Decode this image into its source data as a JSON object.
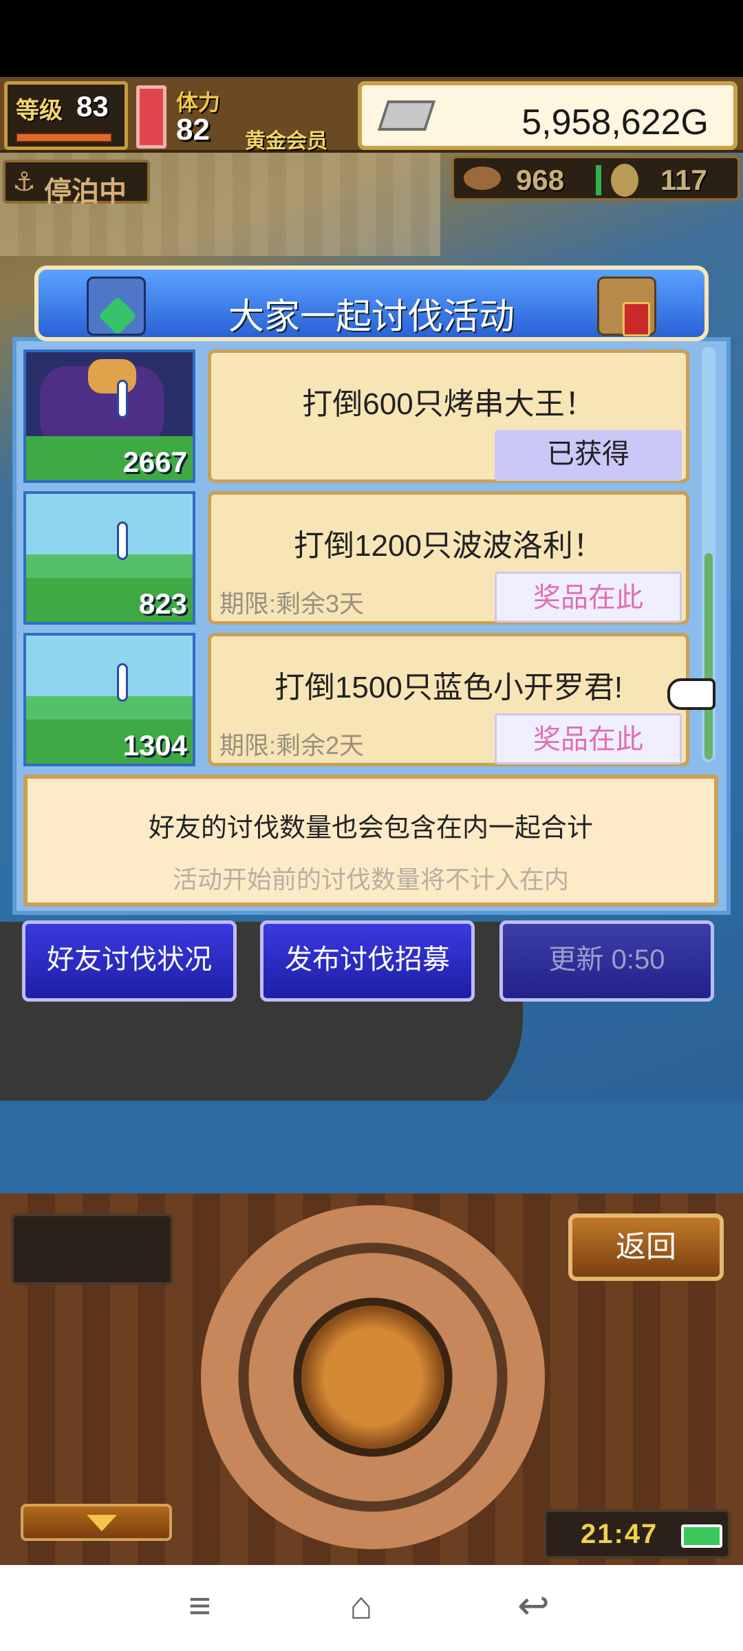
{
  "hud": {
    "level_label": "等级",
    "level_value": "83",
    "stamina_label": "体力",
    "stamina_value": "82",
    "membership": "黄金会员",
    "gold": "5,958,622G",
    "status": "停泊中",
    "resource_1": "968",
    "resource_2": "117"
  },
  "dialog": {
    "title": "大家一起讨伐活动",
    "items": [
      {
        "count": "2667",
        "text": "打倒600只烤串大王！",
        "limit": "",
        "button": "已获得"
      },
      {
        "count": "823",
        "text": "打倒1200只波波洛利！",
        "limit": "期限:剩余3天",
        "button": "奖品在此"
      },
      {
        "count": "1304",
        "text": "打倒1500只蓝色小开罗君!",
        "limit": "期限:剩余2天",
        "button": "奖品在此"
      }
    ],
    "note_line1": "好友的讨伐数量也会包含在内一起合计",
    "note_line2": "活动开始前的讨伐数量将不计入在内"
  },
  "buttons": {
    "friend_status": "好友讨伐状况",
    "publish": "发布讨伐招募",
    "refresh": "更新 0:50"
  },
  "controls": {
    "back": "返回",
    "clock": "21:47"
  },
  "nav": {
    "menu_icon": "menu-icon",
    "home_icon": "home-icon",
    "back_icon": "back-icon"
  }
}
